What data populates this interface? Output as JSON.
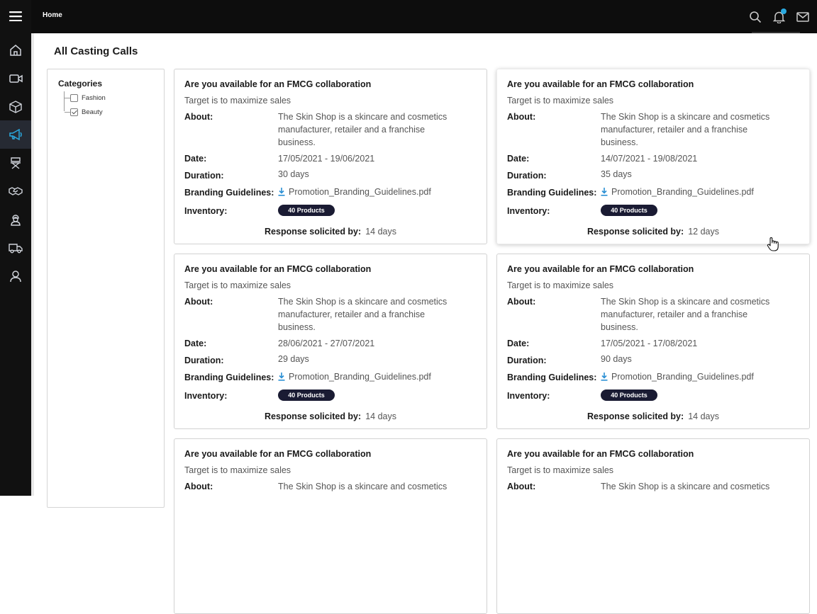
{
  "header": {
    "breadcrumb": "Home"
  },
  "sidebar": {
    "items": [
      "home-icon",
      "video-icon",
      "box-icon",
      "megaphone-icon",
      "director-chair-icon",
      "handshake-icon",
      "worker-icon",
      "truck-icon",
      "user-icon"
    ]
  },
  "page": {
    "title": "All Casting Calls"
  },
  "categories": {
    "title": "Categories",
    "items": [
      {
        "label": "Fashion",
        "checked": false
      },
      {
        "label": "Beauty",
        "checked": true
      }
    ]
  },
  "labels": {
    "about": "About:",
    "date": "Date:",
    "duration": "Duration:",
    "branding": "Branding Guidelines:",
    "inventory": "Inventory:",
    "response": "Response solicited by:"
  },
  "cards": [
    {
      "title": "Are you available for an FMCG collaboration",
      "subtitle": "Target is to maximize sales",
      "about": "The Skin Shop is a skincare and cosmetics manufacturer, retailer and a franchise business.",
      "date": "17/05/2021 - 19/06/2021",
      "duration": "30 days",
      "file": "Promotion_Branding_Guidelines.pdf",
      "inventory": "40 Products",
      "response": "14 days"
    },
    {
      "title": "Are you available for an FMCG collaboration",
      "subtitle": "Target is to maximize sales",
      "about": "The Skin Shop is a skincare and cosmetics manufacturer, retailer and a franchise business.",
      "date": "14/07/2021 - 19/08/2021",
      "duration": "35 days",
      "file": "Promotion_Branding_Guidelines.pdf",
      "inventory": "40 Products",
      "response": "12 days"
    },
    {
      "title": "Are you available for an FMCG collaboration",
      "subtitle": "Target is to maximize sales",
      "about": "The Skin Shop is a skincare and cosmetics manufacturer, retailer and a franchise business.",
      "date": "28/06/2021 - 27/07/2021",
      "duration": "29 days",
      "file": "Promotion_Branding_Guidelines.pdf",
      "inventory": "40 Products",
      "response": "14 days"
    },
    {
      "title": "Are you available for an FMCG collaboration",
      "subtitle": "Target is to maximize sales",
      "about": "The Skin Shop is a skincare and cosmetics manufacturer, retailer and a franchise business.",
      "date": "17/05/2021 - 17/08/2021",
      "duration": "90 days",
      "file": "Promotion_Branding_Guidelines.pdf",
      "inventory": "40 Products",
      "response": "14 days"
    },
    {
      "title": "Are you available for an FMCG collaboration",
      "subtitle": "Target is to maximize sales",
      "about": "The Skin Shop is a skincare and cosmetics"
    },
    {
      "title": "Are you available for an FMCG collaboration",
      "subtitle": "Target is to maximize sales",
      "about": "The Skin Shop is a skincare and cosmetics"
    }
  ]
}
